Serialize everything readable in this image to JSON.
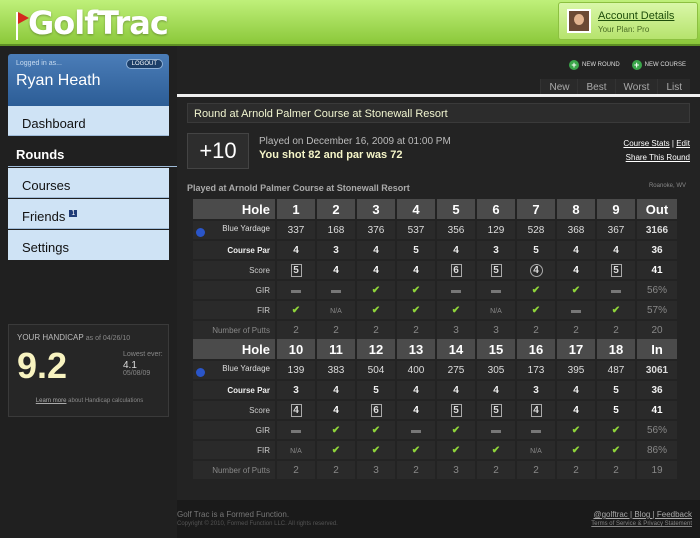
{
  "header": {
    "logo_text": "GolfTrac",
    "account_link": "Account Details",
    "plan": "Your Plan: Pro"
  },
  "sidebar": {
    "logged_in_label": "Logged in as...",
    "logout_label": "LOGOUT",
    "user_name": "Ryan Heath",
    "nav": [
      "Dashboard",
      "Rounds",
      "Courses",
      "Friends",
      "Settings"
    ],
    "friends_badge": "1",
    "handicap": {
      "label": "YOUR HANDICAP",
      "as_of": "as of 04/26/10",
      "value": "9.2",
      "lowest_label": "Lowest ever:",
      "lowest_value": "4.1",
      "lowest_date": "05/08/09",
      "link_prefix": "Learn more",
      "link_suffix": "about Handicap calculations"
    }
  },
  "actions": {
    "new_round": "NEW ROUND",
    "new_course": "NEW COURSE"
  },
  "tabs": [
    "New",
    "Best",
    "Worst",
    "List"
  ],
  "round": {
    "title": "Round at Arnold Palmer Course at Stonewall Resort",
    "score_to_par": "+10",
    "played_on": "Played on December 16, 2009 at 01:00 PM",
    "summary": "You shot 82 and par was 72",
    "course_stats": "Course Stats",
    "edit": "Edit",
    "share": "Share This Round",
    "played_at": "Played at Arnold Palmer Course at Stonewall Resort",
    "location": "Roanoke, WV"
  },
  "scorecard": {
    "front": {
      "hole_label": "Hole",
      "holes": [
        "1",
        "2",
        "3",
        "4",
        "5",
        "6",
        "7",
        "8",
        "9"
      ],
      "total_label": "Out",
      "yardage_label": "Blue Yardage",
      "yardage": [
        "337",
        "168",
        "376",
        "537",
        "356",
        "129",
        "528",
        "368",
        "367"
      ],
      "yardage_total": "3166",
      "par_label": "Course Par",
      "par": [
        "4",
        "3",
        "4",
        "5",
        "4",
        "3",
        "5",
        "4",
        "4"
      ],
      "par_total": "36",
      "score_label": "Score",
      "score": [
        {
          "v": "5",
          "m": "sq"
        },
        {
          "v": "4",
          "m": ""
        },
        {
          "v": "4",
          "m": ""
        },
        {
          "v": "4",
          "m": ""
        },
        {
          "v": "6",
          "m": "sq"
        },
        {
          "v": "5",
          "m": "sq"
        },
        {
          "v": "4",
          "m": "ci"
        },
        {
          "v": "4",
          "m": ""
        },
        {
          "v": "5",
          "m": "sq"
        }
      ],
      "score_total": "41",
      "gir_label": "GIR",
      "gir": [
        "no",
        "no",
        "yes",
        "yes",
        "no",
        "no",
        "yes",
        "yes",
        "no"
      ],
      "gir_total": "56%",
      "fir_label": "FIR",
      "fir": [
        "yes",
        "N/A",
        "yes",
        "yes",
        "yes",
        "N/A",
        "yes",
        "no",
        "yes"
      ],
      "fir_total": "57%",
      "putts_label": "Number of Putts",
      "putts": [
        "2",
        "2",
        "2",
        "2",
        "3",
        "3",
        "2",
        "2",
        "2"
      ],
      "putts_total": "20"
    },
    "back": {
      "hole_label": "Hole",
      "holes": [
        "10",
        "11",
        "12",
        "13",
        "14",
        "15",
        "16",
        "17",
        "18"
      ],
      "total_label": "In",
      "yardage_label": "Blue Yardage",
      "yardage": [
        "139",
        "383",
        "504",
        "400",
        "275",
        "305",
        "173",
        "395",
        "487"
      ],
      "yardage_total": "3061",
      "par_label": "Course Par",
      "par": [
        "3",
        "4",
        "5",
        "4",
        "4",
        "4",
        "3",
        "4",
        "5"
      ],
      "par_total": "36",
      "score_label": "Score",
      "score": [
        {
          "v": "4",
          "m": "sq"
        },
        {
          "v": "4",
          "m": ""
        },
        {
          "v": "6",
          "m": "sq"
        },
        {
          "v": "4",
          "m": ""
        },
        {
          "v": "5",
          "m": "sq"
        },
        {
          "v": "5",
          "m": "sq"
        },
        {
          "v": "4",
          "m": "sq"
        },
        {
          "v": "4",
          "m": ""
        },
        {
          "v": "5",
          "m": ""
        }
      ],
      "score_total": "41",
      "gir_label": "GIR",
      "gir": [
        "no",
        "yes",
        "yes",
        "no",
        "yes",
        "no",
        "no",
        "yes",
        "yes"
      ],
      "gir_total": "56%",
      "fir_label": "FIR",
      "fir": [
        "N/A",
        "yes",
        "yes",
        "yes",
        "yes",
        "yes",
        "N/A",
        "yes",
        "yes"
      ],
      "fir_total": "86%",
      "putts_label": "Number of Putts",
      "putts": [
        "2",
        "2",
        "3",
        "2",
        "3",
        "2",
        "2",
        "2",
        "2"
      ],
      "putts_total": "19"
    }
  },
  "footer": {
    "tagline": "Golf Trac is a Formed Function.",
    "copyright": "Copyright © 2010, Formed Function LLC. All rights reserved.",
    "links": "@golftrac | Blog | Feedback",
    "legal": "Terms of Service & Privacy Statement"
  },
  "colors": {
    "accent": "#8bc83a",
    "nav_bg": "#cfe3f5",
    "check": "#8fd43a",
    "yardage_dot": "#2a55c8"
  }
}
